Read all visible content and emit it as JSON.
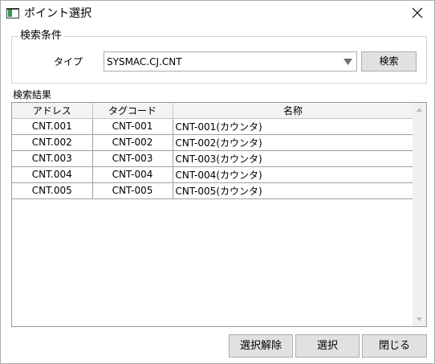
{
  "window": {
    "title": "ポイント選択"
  },
  "search_group": {
    "legend": "検索条件",
    "type_label": "タイプ",
    "type_value": "SYSMAC.CJ.CNT",
    "search_button": "検索"
  },
  "results": {
    "label": "検索結果",
    "columns": [
      "アドレス",
      "タグコード",
      "名称"
    ],
    "rows": [
      [
        "CNT.001",
        "CNT-001",
        "CNT-001(カウンタ)"
      ],
      [
        "CNT.002",
        "CNT-002",
        "CNT-002(カウンタ)"
      ],
      [
        "CNT.003",
        "CNT-003",
        "CNT-003(カウンタ)"
      ],
      [
        "CNT.004",
        "CNT-004",
        "CNT-004(カウンタ)"
      ],
      [
        "CNT.005",
        "CNT-005",
        "CNT-005(カウンタ)"
      ]
    ]
  },
  "footer": {
    "clear_button": "選択解除",
    "select_button": "選択",
    "close_button": "閉じる"
  },
  "colors": {
    "icon_green": "#2e9b52",
    "button_face": "#e1e1e1"
  },
  "icons": {
    "app": "window-app-icon",
    "close": "close-x-icon",
    "dropdown": "triangle-down-icon",
    "scroll_up": "triangle-up-icon",
    "scroll_down": "triangle-down-icon"
  }
}
